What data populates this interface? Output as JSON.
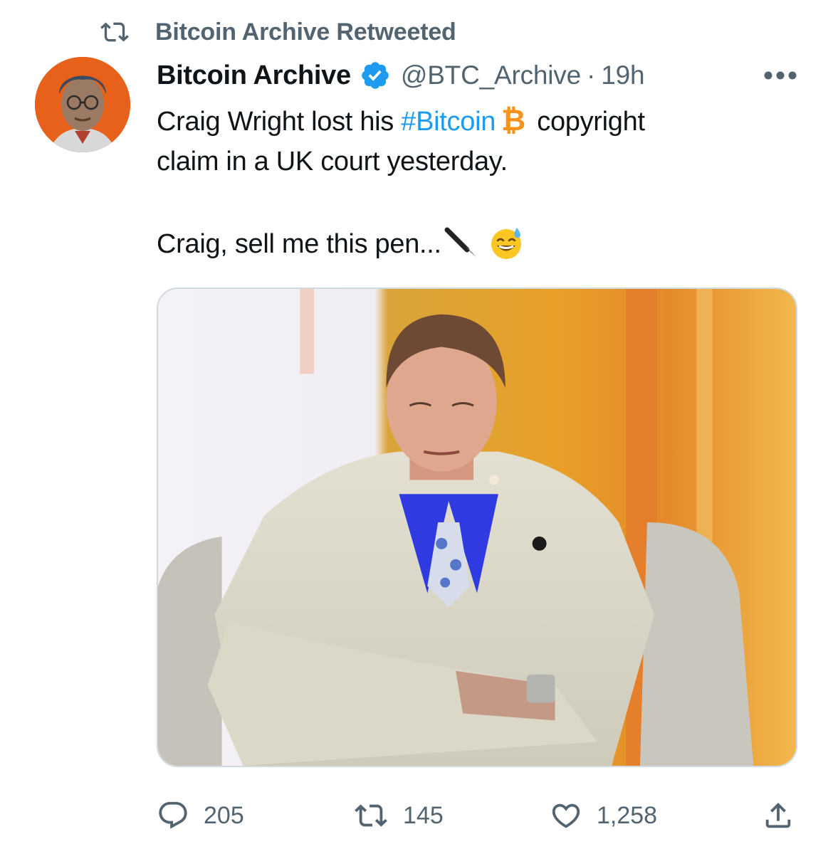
{
  "retweet_header": {
    "label": "Bitcoin Archive Retweeted",
    "icon": "retweet-icon"
  },
  "author": {
    "display_name": "Bitcoin Archive",
    "handle": "@BTC_Archive",
    "separator": "·",
    "timestamp": "19h",
    "verified": true,
    "avatar": "avatar-image"
  },
  "tweet": {
    "line1_pre": "Craig Wright lost his ",
    "hashtag": "#Bitcoin",
    "btc_symbol": "₿",
    "line1_post": " copyright",
    "line2": "claim in a UK court yesterday.",
    "line4": "Craig, sell me this pen...",
    "emojis": [
      "pen-icon",
      "sweat-smile-emoji"
    ]
  },
  "actions": {
    "reply_count": "205",
    "retweet_count": "145",
    "like_count": "1,258"
  },
  "colors": {
    "text": "#0f1419",
    "secondary": "#536471",
    "link": "#1d9bf0",
    "bitcoin": "#f7931a",
    "border": "#cfd9de"
  }
}
